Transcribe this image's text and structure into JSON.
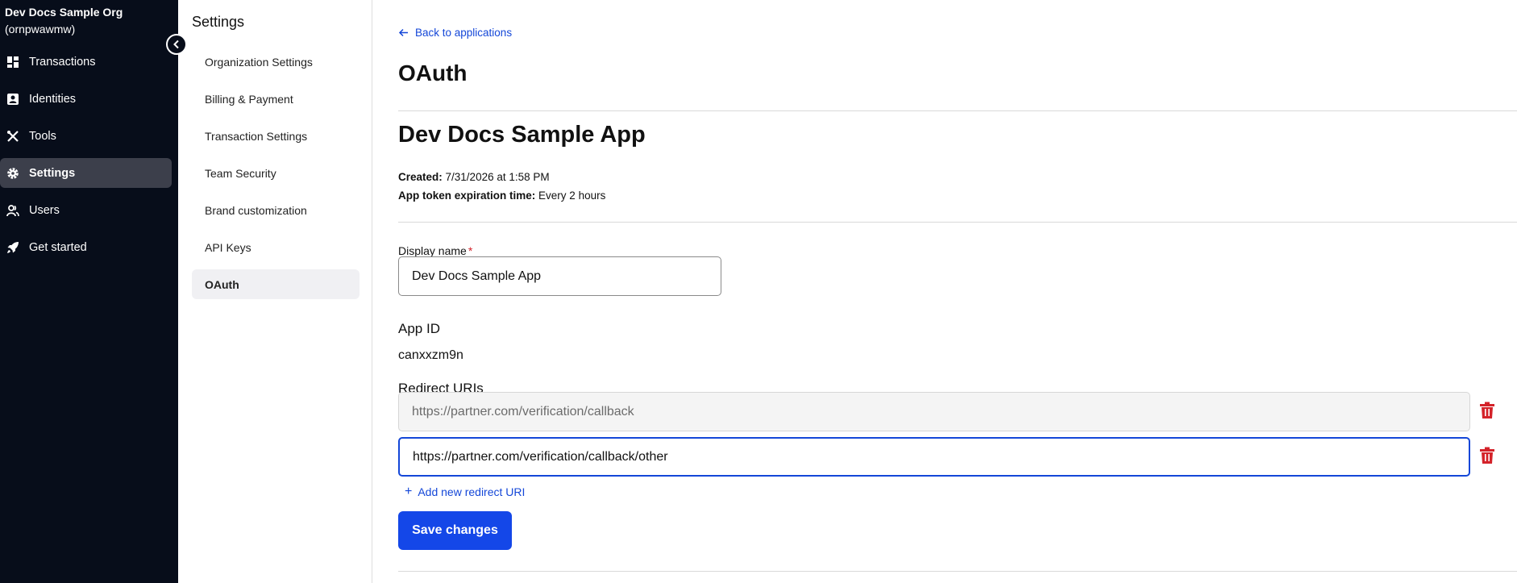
{
  "nav": {
    "org_name": "Dev Docs Sample Org",
    "org_id": "(ornpwawmw)",
    "items": [
      {
        "label": "Transactions",
        "icon": "dashboard-icon"
      },
      {
        "label": "Identities",
        "icon": "id-card-icon"
      },
      {
        "label": "Tools",
        "icon": "tools-icon"
      },
      {
        "label": "Settings",
        "icon": "gear-icon",
        "active": true
      },
      {
        "label": "Users",
        "icon": "users-icon"
      },
      {
        "label": "Get started",
        "icon": "rocket-icon"
      }
    ]
  },
  "subnav": {
    "title": "Settings",
    "items": [
      {
        "label": "Organization Settings"
      },
      {
        "label": "Billing & Payment"
      },
      {
        "label": "Transaction Settings"
      },
      {
        "label": "Team Security"
      },
      {
        "label": "Brand customization"
      },
      {
        "label": "API Keys"
      },
      {
        "label": "OAuth",
        "active": true
      }
    ]
  },
  "main": {
    "back_label": "Back to applications",
    "page_title": "OAuth",
    "app_title": "Dev Docs Sample App",
    "created_label": "Created:",
    "created_value": "7/31/2026 at 1:58 PM",
    "expiration_label": "App token expiration time:",
    "expiration_value": "Every 2 hours",
    "display_name_label": "Display name",
    "required_mark": "*",
    "display_name_value": "Dev Docs Sample App",
    "app_id_label": "App ID",
    "app_id_value": "canxxzm9n",
    "redirect_label": "Redirect URIs",
    "redirect_uris": [
      "https://partner.com/verification/callback",
      "https://partner.com/verification/callback/other"
    ],
    "add_uri_label": "Add new redirect URI",
    "save_label": "Save changes"
  },
  "colors": {
    "nav_bg": "#070d1a",
    "accent": "#1447e8",
    "danger": "#d4232a"
  }
}
